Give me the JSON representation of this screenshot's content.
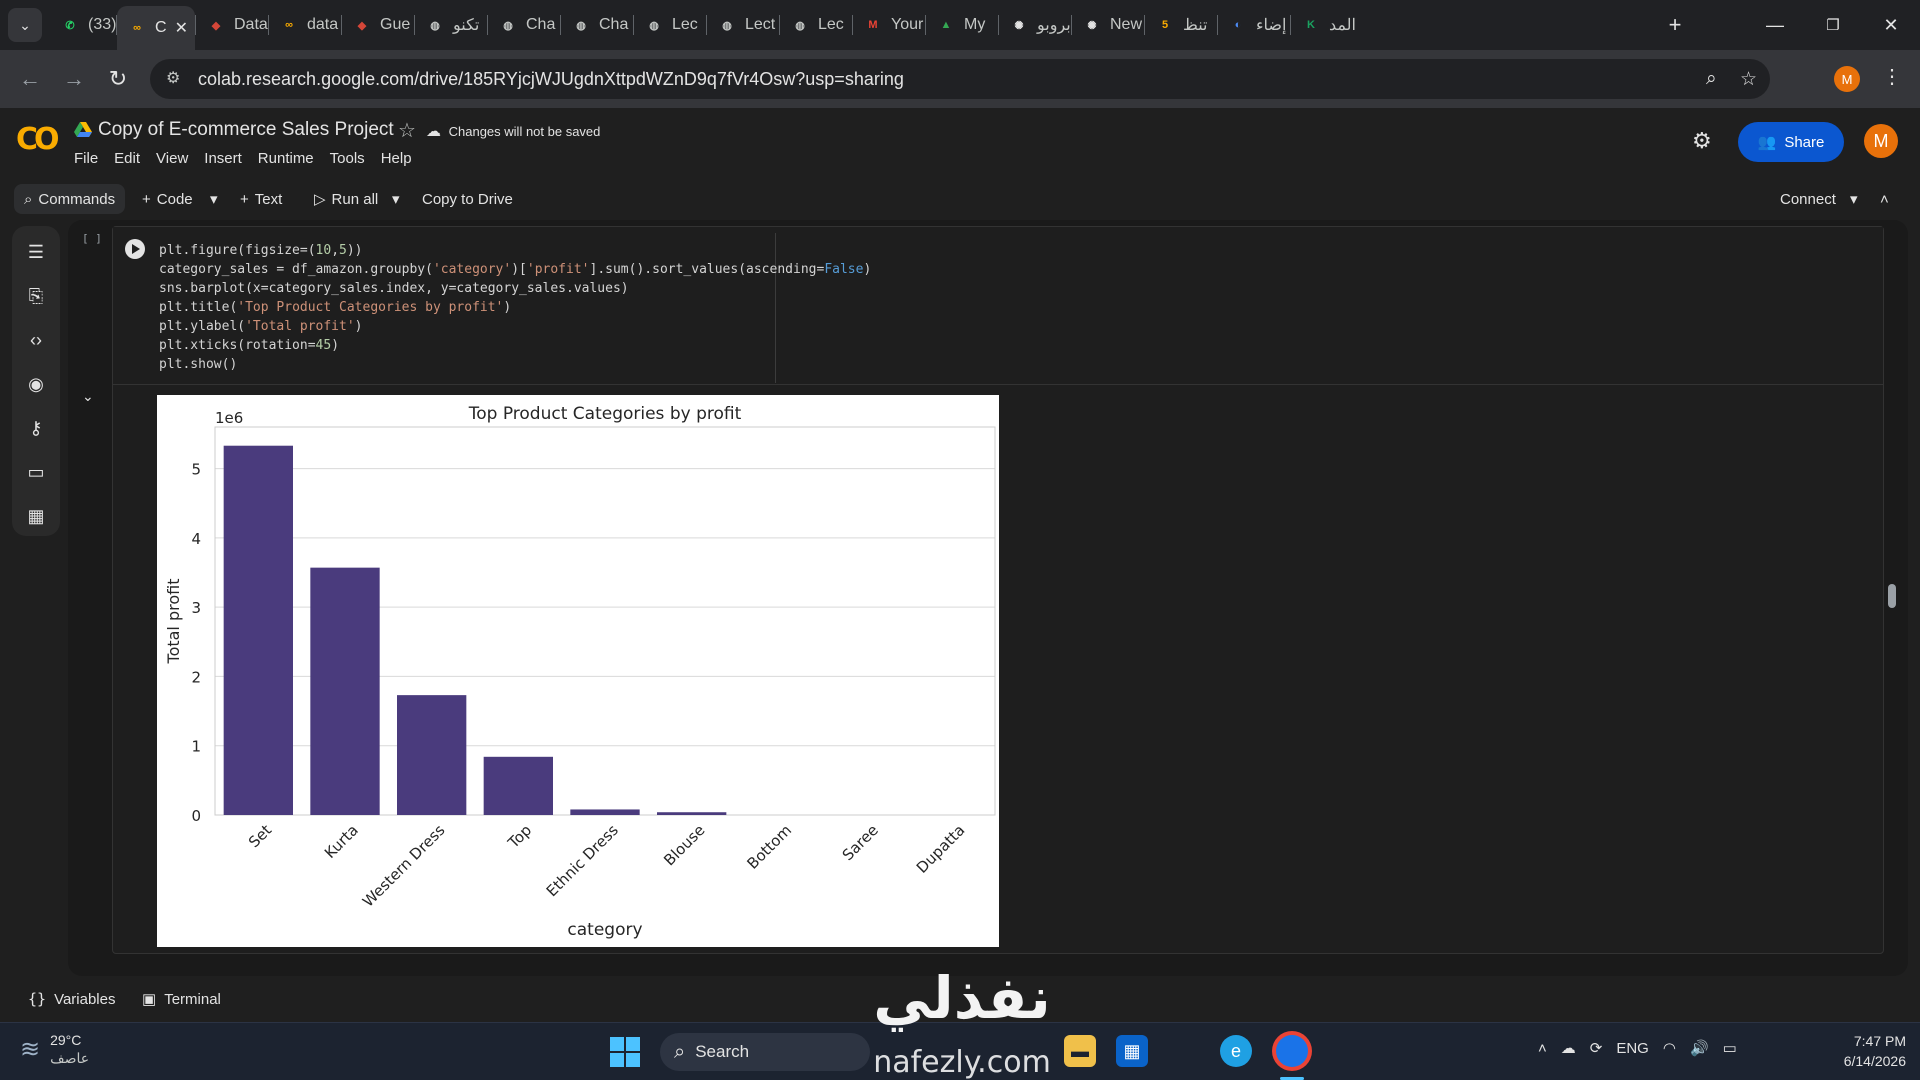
{
  "browser": {
    "tabs": [
      {
        "label": "(33)",
        "icon": "whatsapp-icon",
        "color": "#25d366"
      },
      {
        "label": "C",
        "icon": "colab-icon",
        "color": "#f9ab00",
        "active": true
      },
      {
        "label": "Data",
        "icon": "kaggle-like-icon",
        "color": "#d44638"
      },
      {
        "label": "data",
        "icon": "colab-icon",
        "color": "#f9ab00"
      },
      {
        "label": "Gue",
        "icon": "kaggle-like-icon",
        "color": "#d44638"
      },
      {
        "label": "تكنو",
        "icon": "globe-icon",
        "color": "#c4c7c5"
      },
      {
        "label": "Cha",
        "icon": "globe-icon",
        "color": "#c4c7c5"
      },
      {
        "label": "Cha",
        "icon": "globe-icon",
        "color": "#c4c7c5"
      },
      {
        "label": "Lec",
        "icon": "globe-icon",
        "color": "#c4c7c5"
      },
      {
        "label": "Lect",
        "icon": "globe-icon",
        "color": "#c4c7c5"
      },
      {
        "label": "Lec",
        "icon": "globe-icon",
        "color": "#c4c7c5"
      },
      {
        "label": "Your",
        "icon": "gmail-icon",
        "color": "#ea4335"
      },
      {
        "label": "My",
        "icon": "drive-icon",
        "color": "#34a853"
      },
      {
        "label": "بروبو",
        "icon": "chatgpt-icon",
        "color": "#e3e3e3"
      },
      {
        "label": "New",
        "icon": "chatgpt-icon",
        "color": "#e3e3e3"
      },
      {
        "label": "تنظ",
        "icon": "five-icon",
        "color": "#f9ab00"
      },
      {
        "label": "إضاء",
        "icon": "swirl-icon",
        "color": "#4c8bf5"
      },
      {
        "label": "المد",
        "icon": "k-icon",
        "color": "#1aa260"
      }
    ],
    "tab_count_icon": "chevron-down-icon",
    "url": "colab.research.google.com/drive/185RYjcjWJUgdnXttpdWZnD9q7fVr4Osw?usp=sharing",
    "profile_initial": "M"
  },
  "colab": {
    "title": "Copy of E-commerce Sales Project",
    "save_note": "Changes will not be saved",
    "menu": [
      "File",
      "Edit",
      "View",
      "Insert",
      "Runtime",
      "Tools",
      "Help"
    ],
    "share_label": "Share",
    "avatar_initial": "M",
    "toolbar": {
      "commands": "Commands",
      "code": "Code",
      "text": "Text",
      "run_all": "Run all",
      "copy_to_drive": "Copy to Drive",
      "connect": "Connect"
    },
    "cell": {
      "exec_count": "[ ]",
      "code_lines": [
        "plt.figure(figsize=(10,5))",
        "category_sales = df_amazon.groupby('category')['profit'].sum().sort_values(ascending=False)",
        "sns.barplot(x=category_sales.index, y=category_sales.values)",
        "plt.title('Top Product Categories by profit')",
        "plt.ylabel('Total profit')",
        "plt.xticks(rotation=45)",
        "plt.show()"
      ]
    },
    "statusbar": {
      "variables": "Variables",
      "terminal": "Terminal"
    }
  },
  "chart_data": {
    "type": "bar",
    "title": "Top Product Categories by profit",
    "xlabel": "category",
    "ylabel": "Total profit",
    "offset_label": "1e6",
    "categories": [
      "Set",
      "Kurta",
      "Western Dress",
      "Top",
      "Ethnic Dress",
      "Blouse",
      "Bottom",
      "Saree",
      "Dupatta"
    ],
    "values": [
      5.33,
      3.57,
      1.73,
      0.84,
      0.08,
      0.04,
      0.0,
      0.0,
      0.0
    ],
    "ylim": [
      0,
      5.6
    ],
    "yticks": [
      0,
      1,
      2,
      3,
      4,
      5
    ],
    "grid": true,
    "bar_color": "#4a3b7d",
    "legend": "none"
  },
  "taskbar": {
    "temperature": "29°C",
    "weather_desc": "عاصف",
    "search": "Search",
    "lang": "ENG",
    "time": "7:47 PM",
    "date": "6/14/2026"
  },
  "watermark": {
    "top": "نفذلي",
    "bottom": "nafezly.com"
  }
}
